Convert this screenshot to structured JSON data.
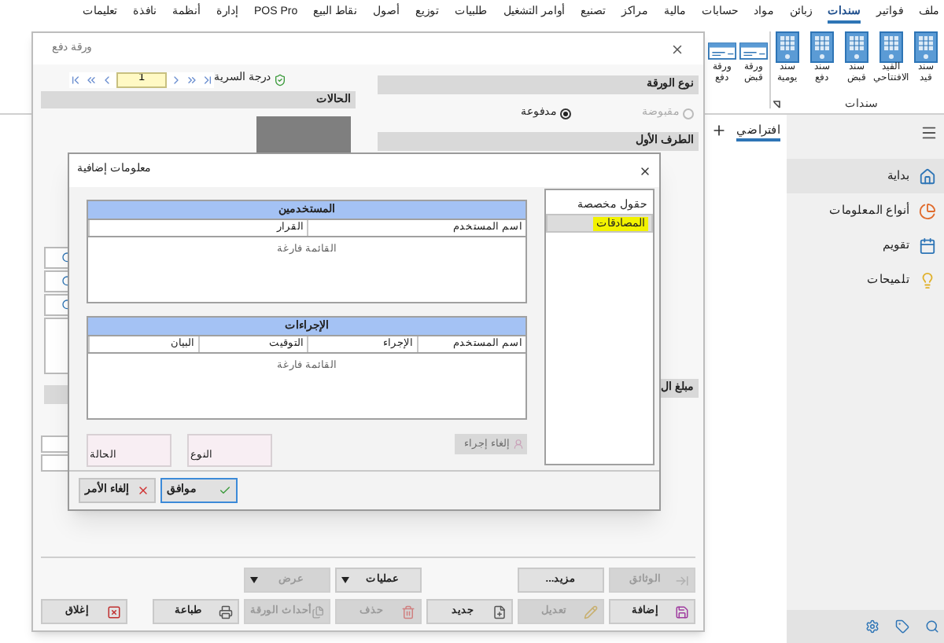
{
  "menu_bar": [
    {
      "label": "ملف",
      "selected": false
    },
    {
      "label": "فواتير",
      "selected": false
    },
    {
      "label": "سندات",
      "selected": true
    },
    {
      "label": "زبائن",
      "selected": false
    },
    {
      "label": "مواد",
      "selected": false
    },
    {
      "label": "حسابات",
      "selected": false
    },
    {
      "label": "مالية",
      "selected": false
    },
    {
      "label": "مراكز",
      "selected": false
    },
    {
      "label": "تصنيع",
      "selected": false
    },
    {
      "label": "أوامر التشغيل",
      "selected": false
    },
    {
      "label": "طلبيات",
      "selected": false
    },
    {
      "label": "توزيع",
      "selected": false
    },
    {
      "label": "أصول",
      "selected": false
    },
    {
      "label": "نقاط البيع",
      "selected": false
    },
    {
      "label": "POS Pro",
      "selected": false
    },
    {
      "label": "إدارة",
      "selected": false
    },
    {
      "label": "أنظمة",
      "selected": false
    },
    {
      "label": "نافذة",
      "selected": false
    },
    {
      "label": "تعليمات",
      "selected": false
    }
  ],
  "ribbon": {
    "group_label": "سندات",
    "buttons": [
      {
        "label": "سند قيد",
        "kind": "voucher"
      },
      {
        "label": "القيد الافتتاحي",
        "kind": "voucher"
      },
      {
        "label": "سند قبض",
        "kind": "voucher"
      },
      {
        "label": "سند دفع",
        "kind": "voucher"
      },
      {
        "label": "سند يومية",
        "kind": "voucher"
      },
      {
        "label": "ورقة قبض",
        "kind": "note"
      },
      {
        "label": "ورقة دفع",
        "kind": "note"
      }
    ]
  },
  "sidebar": {
    "tabs": [
      {
        "label": "افتراضي",
        "selected": true
      }
    ],
    "items": [
      {
        "label": "بداية",
        "kind": "home",
        "selected": true
      },
      {
        "label": "أنواع المعلومات",
        "kind": "chart",
        "selected": false
      },
      {
        "label": "تقويم",
        "kind": "calendar",
        "selected": false
      },
      {
        "label": "تلميحات",
        "kind": "tips",
        "selected": false
      }
    ]
  },
  "window": {
    "title": "ورقة دفع",
    "record_number": "1",
    "secrecy_label": "درجة السرية",
    "document_type": {
      "title": "نوع الورقة",
      "options": [
        {
          "label": "مقبوضة",
          "selected": false
        },
        {
          "label": "مدفوعة",
          "selected": true
        }
      ]
    },
    "first_party_title": "الطرف الأول",
    "amount_title": "مبلغ ال",
    "statuses_title": "الحالات",
    "button_rows": [
      [
        {
          "label": "الوثائق",
          "kind": "button",
          "disabled": true
        },
        {
          "label": "مزيد...",
          "kind": "button",
          "disabled": false
        },
        {
          "label": "عمليات",
          "kind": "dropdown",
          "disabled": false
        },
        {
          "label": "عرض",
          "kind": "dropdown",
          "disabled": true
        }
      ],
      [
        {
          "label": "إضافة",
          "kind": "button",
          "disabled": false
        },
        {
          "label": "تعديل",
          "kind": "button",
          "disabled": true
        },
        {
          "label": "جديد",
          "kind": "button",
          "disabled": false
        },
        {
          "label": "حذف",
          "kind": "button",
          "disabled": true
        },
        {
          "label": "أحداث الورقة",
          "kind": "button",
          "disabled": true
        },
        {
          "label": "طباعة",
          "kind": "button",
          "disabled": false
        },
        {
          "label": "إغلاق",
          "kind": "button",
          "disabled": false
        }
      ]
    ]
  },
  "dialog": {
    "title": "معلومات إضافية",
    "nav": [
      {
        "label": "حقول مخصصة",
        "selected": false,
        "highlighted": false
      },
      {
        "label": "المصادقات",
        "selected": true,
        "highlighted": true
      }
    ],
    "users": {
      "title": "المستخدمين",
      "columns": [
        "اسم المستخدم",
        "القرار"
      ],
      "empty_text": "القائمة فارغة"
    },
    "actions": {
      "title": "الإجراءات",
      "columns": [
        "اسم المستخدم",
        "الإجراء",
        "التوقيت",
        "البيان"
      ],
      "empty_text": "القائمة فارغة"
    },
    "fields": [
      {
        "label": "النوع"
      },
      {
        "label": "الحالة"
      }
    ],
    "cancel_action": {
      "label": "إلغاء إجراء",
      "disabled": true
    },
    "buttons": [
      {
        "label": "موافق",
        "default": true
      },
      {
        "label": "إلغاء الأمر",
        "default": false
      }
    ]
  }
}
